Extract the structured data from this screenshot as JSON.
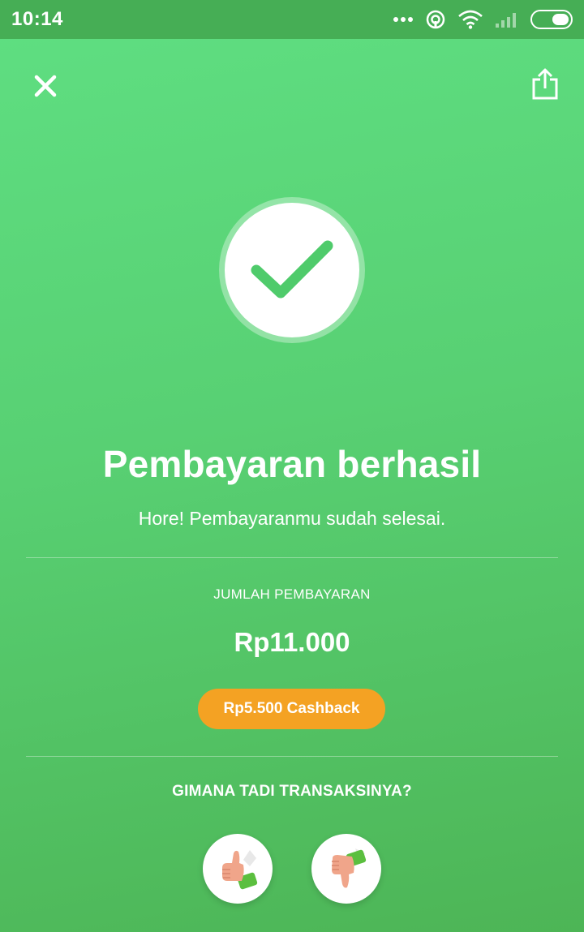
{
  "status_bar": {
    "time": "10:14"
  },
  "header": {
    "close_icon": "close-icon",
    "share_icon": "share-icon"
  },
  "result": {
    "status_icon": "checkmark-icon",
    "title": "Pembayaran berhasil",
    "subtitle": "Hore! Pembayaranmu sudah selesai."
  },
  "payment": {
    "amount_label": "JUMLAH PEMBAYARAN",
    "amount": "Rp11.000",
    "cashback_label": "Rp5.500 Cashback"
  },
  "feedback": {
    "question": "GIMANA TADI TRANSAKSINYA?",
    "options": [
      {
        "icon": "thumbs-up-icon"
      },
      {
        "icon": "thumbs-down-icon"
      }
    ]
  },
  "colors": {
    "background": "#58d073",
    "status_bar": "#46ae55",
    "cashback_badge": "#f4a223",
    "check": "#4fcb6b"
  }
}
